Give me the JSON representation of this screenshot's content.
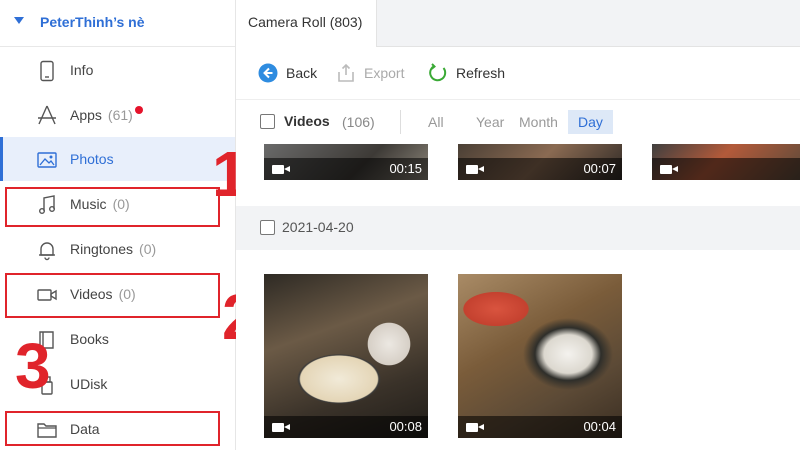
{
  "device": {
    "name": "PeterThinh’s nè"
  },
  "sidebar": {
    "items": [
      {
        "label": "Info",
        "count": ""
      },
      {
        "label": "Apps",
        "count": "(61)"
      },
      {
        "label": "Photos",
        "count": ""
      },
      {
        "label": "Music",
        "count": "(0)"
      },
      {
        "label": "Ringtones",
        "count": "(0)"
      },
      {
        "label": "Videos",
        "count": "(0)"
      },
      {
        "label": "Books",
        "count": ""
      },
      {
        "label": "UDisk",
        "count": ""
      },
      {
        "label": "Data",
        "count": ""
      }
    ]
  },
  "annotations": {
    "one": "1",
    "two": "2",
    "three": "3"
  },
  "tabs": [
    {
      "label": "Camera Roll (803)"
    }
  ],
  "toolbar": {
    "back": "Back",
    "export": "Export",
    "refresh": "Refresh"
  },
  "filter": {
    "category": "Videos",
    "count": "(106)",
    "periods": [
      "All",
      "Year",
      "Month",
      "Day"
    ],
    "selected_period": "Day"
  },
  "groups": [
    {
      "date": "",
      "thumbs": [
        {
          "duration": "00:15"
        },
        {
          "duration": "00:07"
        },
        {
          "duration": ""
        }
      ]
    },
    {
      "date": "2021-04-20",
      "thumbs": [
        {
          "duration": "00:08"
        },
        {
          "duration": "00:04"
        }
      ]
    }
  ],
  "colors": {
    "accent": "#2f6fd6",
    "annotation": "#e0242b",
    "badge": "#e5132b",
    "refresh": "#3aa935"
  }
}
